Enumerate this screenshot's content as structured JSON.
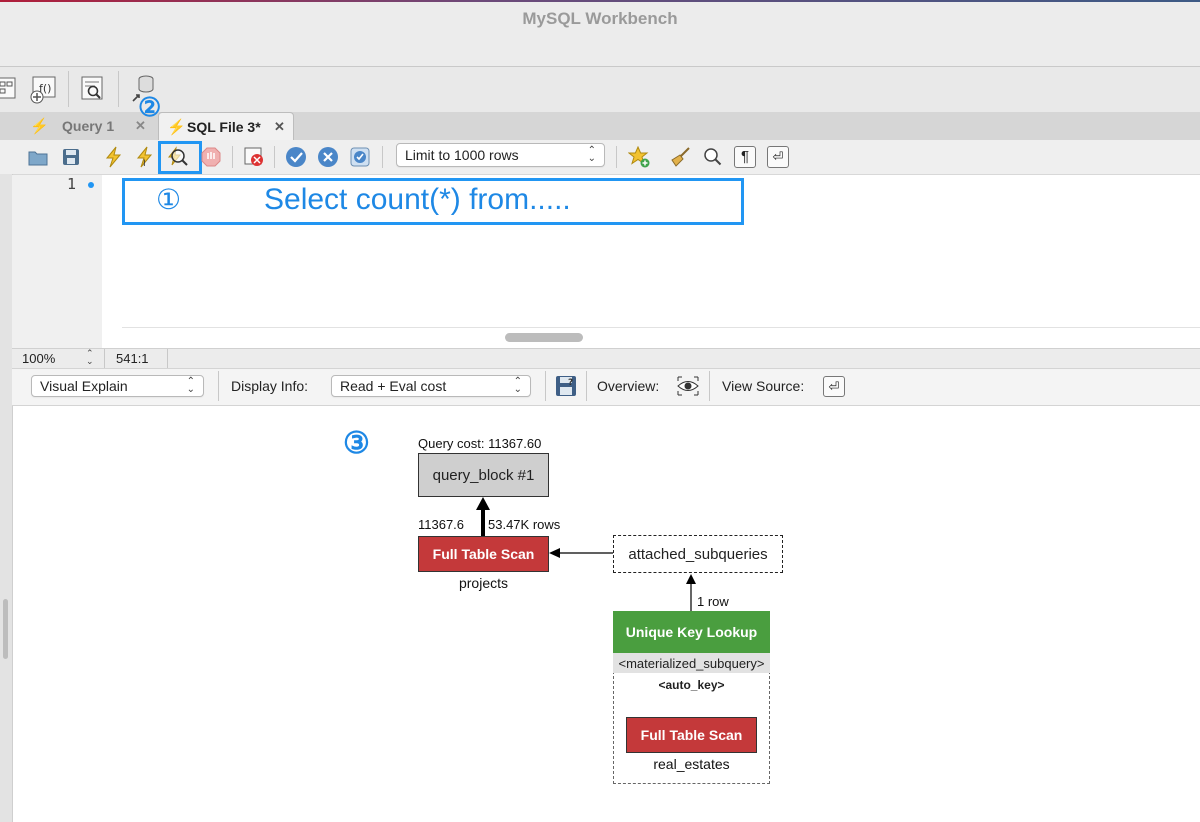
{
  "window": {
    "title": "MySQL Workbench"
  },
  "tabs": [
    {
      "label": "Query 1",
      "active": false
    },
    {
      "label": "SQL File 3*",
      "active": true
    }
  ],
  "editor_toolbar": {
    "limit_select": "Limit to 1000 rows"
  },
  "editor": {
    "line_number": "1",
    "code": "Select count(*) from....."
  },
  "annotations": {
    "one": "①",
    "two": "②",
    "three": "③"
  },
  "status": {
    "zoom": "100%",
    "position": "541:1"
  },
  "explain_toolbar": {
    "view_select": "Visual Explain",
    "display_info_label": "Display Info:",
    "display_info_select": "Read + Eval cost",
    "overview_label": "Overview:",
    "view_source_label": "View Source:"
  },
  "diagram": {
    "query_cost": "Query cost: 11367.60",
    "query_block": "query_block #1",
    "edge_cost": "11367.6",
    "edge_rows": "53.47K rows",
    "scan1_label": "Full Table Scan",
    "scan1_table": "projects",
    "attached": "attached_subqueries",
    "edge_row2": "1 row",
    "lookup_label": "Unique Key Lookup",
    "lookup_table": "<materialized_subquery>",
    "lookup_key": "<auto_key>",
    "scan2_label": "Full Table Scan",
    "scan2_table": "real_estates"
  },
  "colors": {
    "accent": "#2196f3",
    "scan_red": "#c4393a",
    "lookup_green": "#4a9e3f",
    "query_block_grey": "#cfcfcf"
  }
}
